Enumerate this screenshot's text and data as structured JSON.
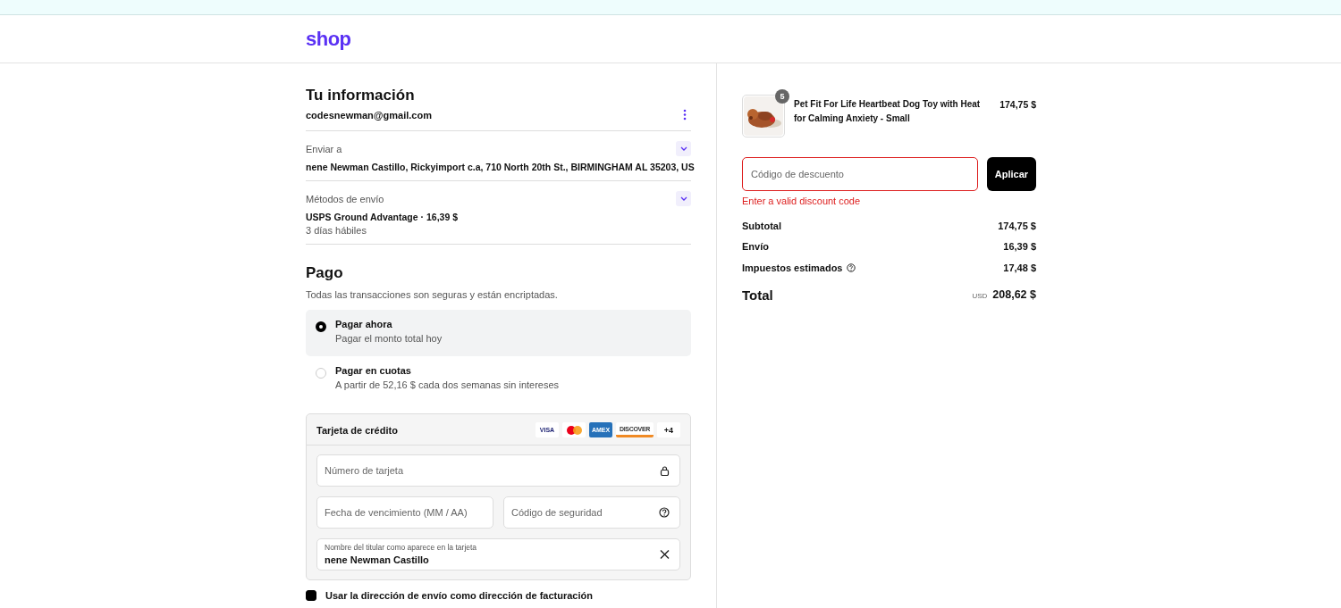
{
  "header": {
    "logo": "shop"
  },
  "contact": {
    "title": "Tu información",
    "email": "codesnewman@gmail.com"
  },
  "sections": [
    {
      "label": "Enviar a",
      "lines": [
        "nene Newman Castillo, Rickyimport c.a, 710 North 20th St., BIRMINGHAM AL 35203, US"
      ],
      "expanded": false
    },
    {
      "label": "Métodos de envío",
      "lines": [
        "USPS Ground Advantage · 16,39 $",
        "3 días hábiles"
      ],
      "expanded": false
    }
  ],
  "payment": {
    "title": "Pago",
    "subtitle": "Todas las transacciones son seguras y están encriptadas.",
    "options": [
      {
        "label": "Pagar ahora",
        "detail": "Pagar el monto total hoy",
        "selected": true
      },
      {
        "label": "Pagar en cuotas",
        "detail": "A partir de 52,16 $ cada dos semanas sin intereses",
        "selected": false
      }
    ],
    "card": {
      "title": "Tarjeta de crédito",
      "brands": [
        {
          "kind": "visa",
          "label": "VISA"
        },
        {
          "kind": "mastercard"
        },
        {
          "kind": "amex",
          "label": "AMEX"
        },
        {
          "kind": "discover",
          "label": "DISCOVER"
        },
        {
          "kind": "more",
          "label": "+4"
        }
      ],
      "number": {
        "placeholder": "Número de tarjeta"
      },
      "expiry": {
        "placeholder": "Fecha de vencimiento (MM / AA)"
      },
      "cvv": {
        "placeholder": "Código de seguridad"
      },
      "name": {
        "label": "Nombre del titular como aparece en la tarjeta",
        "value": "nene Newman Castillo"
      }
    },
    "billing": {
      "label": "Usar la dirección de envío como dirección de facturación",
      "checked": true
    }
  },
  "summary": {
    "item": {
      "name": "Pet Fit For Life Heartbeat Dog Toy with Heat for Calming Anxiety - Small",
      "price": "174,75 $",
      "quantity": "5"
    },
    "discount": {
      "placeholder": "Código de descuento",
      "button": "Aplicar",
      "error": "Enter a valid discount code"
    },
    "lines": [
      {
        "label": "Subtotal",
        "value": "174,75 $",
        "info": false
      },
      {
        "label": "Envío",
        "value": "16,39 $",
        "info": false
      },
      {
        "label": "Impuestos estimados",
        "value": "17,48 $",
        "info": true
      }
    ],
    "total": {
      "label": "Total",
      "currency": "USD",
      "value": "208,62 $"
    }
  }
}
